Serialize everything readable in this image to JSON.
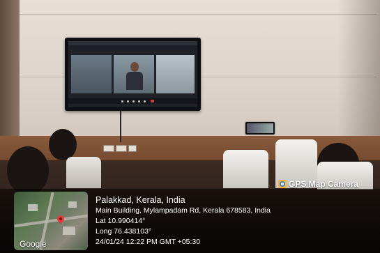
{
  "stamp": {
    "brand": "GPS Map Camera",
    "brand_icon": "gps-map-camera-app-icon",
    "title": "Palakkad, Kerala, India",
    "address": "Main Building, Mylampadam Rd, Kerala 678583, India",
    "lat": "Lat 10.990414°",
    "long": "Long 76.438103°",
    "datetime": "24/01/24 12:22 PM GMT +05:30",
    "map_attribution": "Google"
  },
  "colors": {
    "overlay": "#000000",
    "text": "#ffffff",
    "pin": "#e53935",
    "brand_icon_bg": "#f0b43a"
  }
}
